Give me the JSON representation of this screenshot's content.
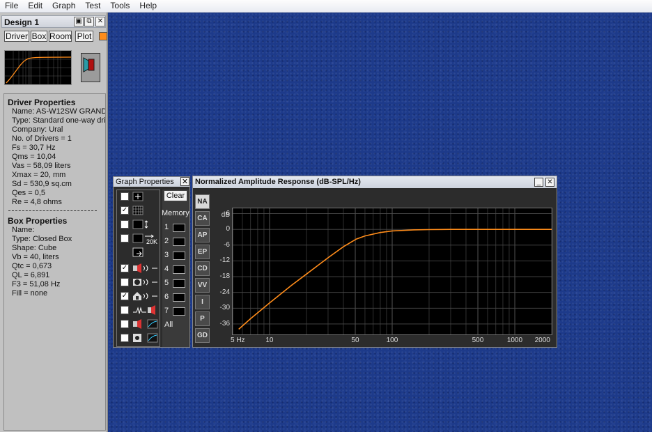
{
  "menu": [
    "File",
    "Edit",
    "Graph",
    "Test",
    "Tools",
    "Help"
  ],
  "design": {
    "title": "Design 1",
    "tabs": [
      "Driver",
      "Box",
      "Room",
      "Plot"
    ],
    "plot_color": "#ff8c1a"
  },
  "driver": {
    "heading": "Driver Properties",
    "lines": [
      "Name: AS-W12SW GRAND",
      "Type: Standard one-way driv",
      "Company: Ural",
      "No. of Drivers = 1",
      "Fs = 30,7 Hz",
      "Qms = 10,04",
      "Vas = 58,09 liters",
      "Xmax = 20, mm",
      "Sd = 530,9 sq.cm",
      "Qes = 0,5",
      "Re = 4,8 ohms"
    ]
  },
  "box": {
    "heading": "Box Properties",
    "lines": [
      "Name:",
      "Type: Closed Box",
      "Shape: Cube",
      "Vb = 40, liters",
      "Qtc = 0,673",
      "QL = 6,891",
      "F3 = 51,08 Hz",
      "Fill = none"
    ]
  },
  "graph_properties": {
    "title": "Graph Properties",
    "clear_label": "Clear",
    "memory_label": "Memory",
    "memory_slots": [
      "1",
      "2",
      "3",
      "4",
      "5",
      "6",
      "7"
    ],
    "all_label": "All",
    "icon_20k": "20K",
    "checkboxes": [
      false,
      true,
      false,
      false,
      true,
      false,
      true,
      false,
      false,
      false
    ]
  },
  "graph": {
    "title": "Normalized Amplitude Response (dB-SPL/Hz)",
    "tabs": [
      "NA",
      "CA",
      "AP",
      "EP",
      "CD",
      "VV",
      "I",
      "P",
      "GD"
    ],
    "active_tab": "NA",
    "curve_color": "#ff8c1a"
  },
  "chart_data": {
    "type": "line",
    "title": "Normalized Amplitude Response (dB-SPL/Hz)",
    "ylabel": "dB",
    "xlabel": "",
    "x_scale": "log",
    "xlim": [
      5,
      2000
    ],
    "ylim": [
      -40,
      8
    ],
    "y_ticks": [
      6,
      0,
      -6,
      -12,
      -18,
      -24,
      -30,
      -36
    ],
    "x_ticks": [
      {
        "value": 5,
        "label": "5 Hz"
      },
      {
        "value": 10,
        "label": "10"
      },
      {
        "value": 50,
        "label": "50"
      },
      {
        "value": 100,
        "label": "100"
      },
      {
        "value": 500,
        "label": "500"
      },
      {
        "value": 1000,
        "label": "1000"
      },
      {
        "value": 2000,
        "label": "2000"
      }
    ],
    "grid": true,
    "series": [
      {
        "x": [
          5.6,
          7,
          10,
          15,
          20,
          30,
          40,
          51,
          60,
          80,
          100,
          150,
          200,
          300,
          500,
          1000,
          2000
        ],
        "y": [
          -38,
          -34,
          -28,
          -21.4,
          -17,
          -10.8,
          -6.6,
          -3.7,
          -2.5,
          -1.2,
          -0.6,
          -0.2,
          -0.1,
          0,
          0,
          0,
          0
        ]
      }
    ]
  }
}
